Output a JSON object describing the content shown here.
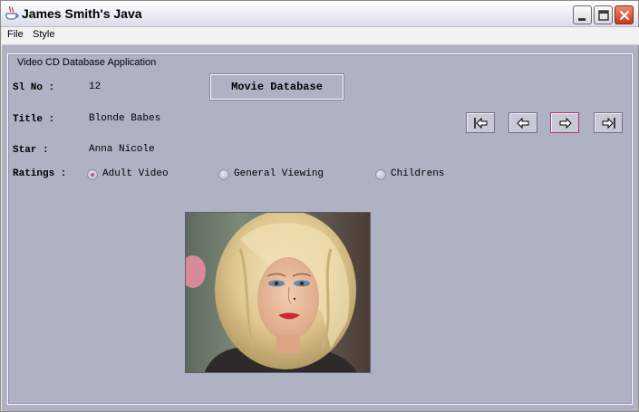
{
  "window": {
    "title": "James Smith's Java",
    "icon": "java-cup-icon"
  },
  "menu": {
    "file": "File",
    "style": "Style"
  },
  "group": {
    "title": "Video CD Database Application"
  },
  "form": {
    "slno_label": "Sl No :",
    "slno_value": "12",
    "title_label": "Title :",
    "title_value": "Blonde Babes",
    "star_label": "Star :",
    "star_value": "Anna Nicole",
    "ratings_label": "Ratings :",
    "ratings": [
      {
        "label": "Adult Video",
        "selected": true
      },
      {
        "label": "General Viewing",
        "selected": false
      },
      {
        "label": "Childrens",
        "selected": false
      }
    ]
  },
  "buttons": {
    "movie_db": "Movie Database",
    "nav": [
      "first-record-icon",
      "previous-record-icon",
      "next-record-icon",
      "last-record-icon"
    ]
  },
  "colors": {
    "panel": "#aeb2c3",
    "selected_radio": "#d64a86",
    "focused_button_border": "#b0336a"
  }
}
